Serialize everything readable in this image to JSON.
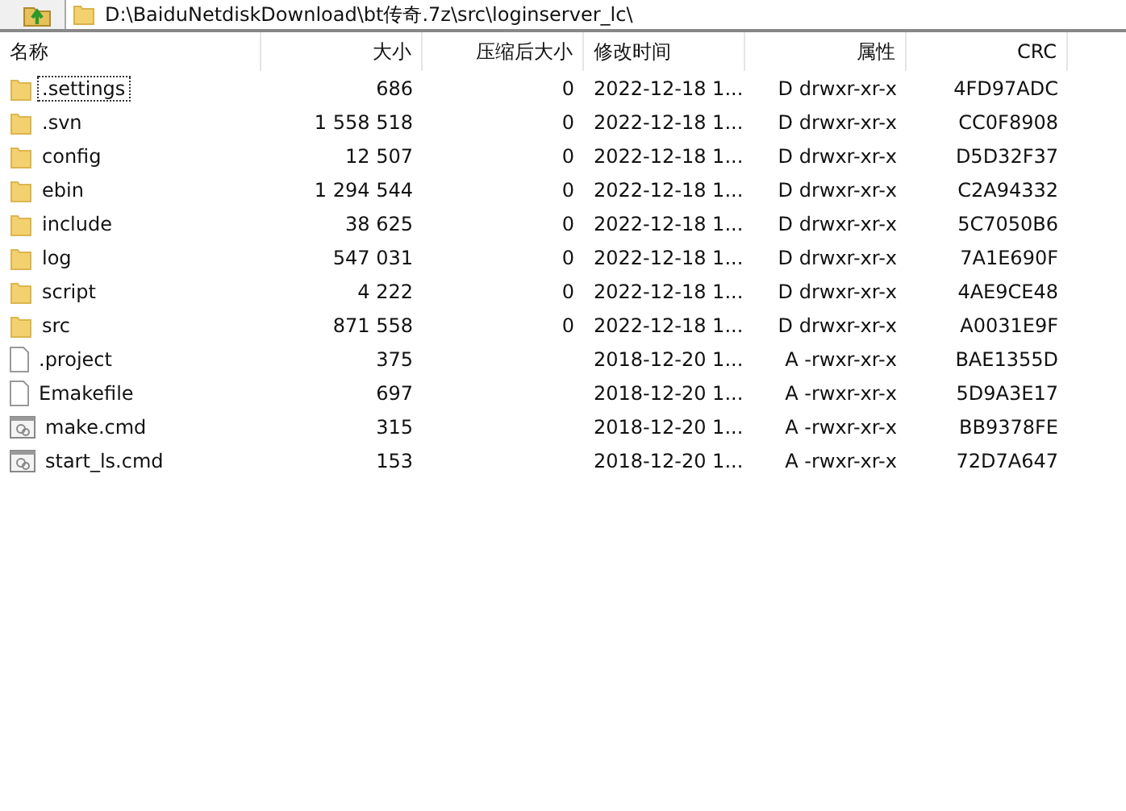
{
  "address_bar": {
    "path": "D:\\BaiduNetdiskDownload\\bt传奇.7z\\src\\loginserver_lc\\"
  },
  "columns": [
    {
      "label": "名称"
    },
    {
      "label": "大小"
    },
    {
      "label": "压缩后大小"
    },
    {
      "label": "修改时间"
    },
    {
      "label": "属性"
    },
    {
      "label": "CRC"
    }
  ],
  "rows": [
    {
      "kind": "folder",
      "name": ".settings",
      "focused": true,
      "size": "686",
      "packed": "0",
      "modified": "2022-12-18 1...",
      "attributes": "D drwxr-xr-x",
      "crc": "4FD97ADC"
    },
    {
      "kind": "folder",
      "name": ".svn",
      "focused": false,
      "size": "1 558 518",
      "packed": "0",
      "modified": "2022-12-18 1...",
      "attributes": "D drwxr-xr-x",
      "crc": "CC0F8908"
    },
    {
      "kind": "folder",
      "name": "config",
      "focused": false,
      "size": "12 507",
      "packed": "0",
      "modified": "2022-12-18 1...",
      "attributes": "D drwxr-xr-x",
      "crc": "D5D32F37"
    },
    {
      "kind": "folder",
      "name": "ebin",
      "focused": false,
      "size": "1 294 544",
      "packed": "0",
      "modified": "2022-12-18 1...",
      "attributes": "D drwxr-xr-x",
      "crc": "C2A94332"
    },
    {
      "kind": "folder",
      "name": "include",
      "focused": false,
      "size": "38 625",
      "packed": "0",
      "modified": "2022-12-18 1...",
      "attributes": "D drwxr-xr-x",
      "crc": "5C7050B6"
    },
    {
      "kind": "folder",
      "name": "log",
      "focused": false,
      "size": "547 031",
      "packed": "0",
      "modified": "2022-12-18 1...",
      "attributes": "D drwxr-xr-x",
      "crc": "7A1E690F"
    },
    {
      "kind": "folder",
      "name": "script",
      "focused": false,
      "size": "4 222",
      "packed": "0",
      "modified": "2022-12-18 1...",
      "attributes": "D drwxr-xr-x",
      "crc": "4AE9CE48"
    },
    {
      "kind": "folder",
      "name": "src",
      "focused": false,
      "size": "871 558",
      "packed": "0",
      "modified": "2022-12-18 1...",
      "attributes": "D drwxr-xr-x",
      "crc": "A0031E9F"
    },
    {
      "kind": "file",
      "name": ".project",
      "focused": false,
      "size": "375",
      "modified": "2018-12-20 1...",
      "attributes": "A -rwxr-xr-x",
      "crc": "BAE1355D"
    },
    {
      "kind": "file",
      "name": "Emakefile",
      "focused": false,
      "size": "697",
      "modified": "2018-12-20 1...",
      "attributes": "A -rwxr-xr-x",
      "crc": "5D9A3E17"
    },
    {
      "kind": "script",
      "name": "make.cmd",
      "focused": false,
      "size": "315",
      "modified": "2018-12-20 1...",
      "attributes": "A -rwxr-xr-x",
      "crc": "BB9378FE"
    },
    {
      "kind": "script",
      "name": "start_ls.cmd",
      "focused": false,
      "size": "153",
      "modified": "2018-12-20 1...",
      "attributes": "A -rwxr-xr-x",
      "crc": "72D7A647"
    }
  ]
}
